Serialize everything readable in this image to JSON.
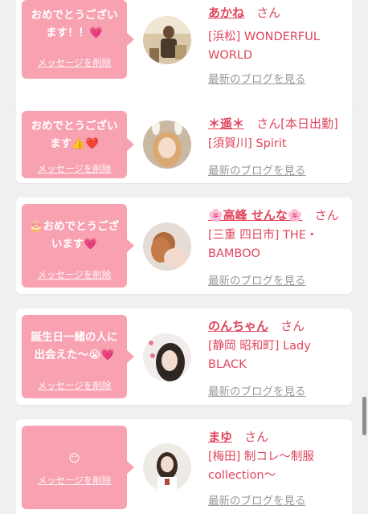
{
  "messages": [
    {
      "bubble_line1": "おめでとうござい",
      "bubble_line2": "ます！！",
      "bubble_emoji": "💗",
      "delete_label": "メッセージを削除",
      "name": "あかね",
      "san": "さん",
      "shop_line1": "[浜松] WONDERFUL",
      "shop_line2": "WORLD",
      "blog_link": "最新のブログを見る"
    },
    {
      "bubble_line1": "おめでとうござい",
      "bubble_line2": "ます",
      "bubble_emoji": "👍❤️",
      "delete_label": "メッセージを削除",
      "name": "＊遥＊",
      "san": "さん",
      "status": "[本日出勤]",
      "shop_line1": "[須賀川] Spirit",
      "blog_link": "最新のブログを見る"
    },
    {
      "bubble_prefix_emoji": "🎂",
      "bubble_line1": "おめでとうござ",
      "bubble_line2": "います",
      "bubble_emoji": "💗",
      "delete_label": "メッセージを削除",
      "name": "🌸高峰 せんな🌸",
      "san": "さん",
      "shop_line1": "[三重 四日市] THE・",
      "shop_line2": "BAMBOO",
      "blog_link": "最新のブログを見る"
    },
    {
      "bubble_line1": "誕生日一緒の人に",
      "bubble_line2": "出会えた〜",
      "bubble_emoji": "😭💗",
      "delete_label": "メッセージを削除",
      "name": "のんちゃん",
      "san": "さん",
      "shop_line1": "[静岡 昭和町] Lady",
      "shop_line2": "BLACK",
      "blog_link": "最新のブログを見る"
    },
    {
      "bubble_emoji": "😶",
      "delete_label": "メッセージを削除",
      "name": "まゆ",
      "san": "さん",
      "shop_line1": "[梅田] 制コレ〜制服",
      "shop_line2": "collection〜",
      "blog_link": "最新のブログを見る"
    }
  ]
}
